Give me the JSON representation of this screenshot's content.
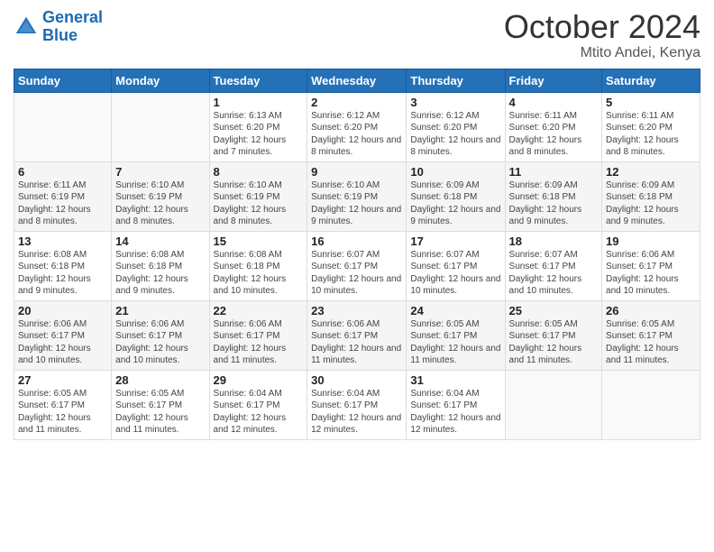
{
  "logo": {
    "line1": "General",
    "line2": "Blue"
  },
  "title": "October 2024",
  "location": "Mtito Andei, Kenya",
  "days_of_week": [
    "Sunday",
    "Monday",
    "Tuesday",
    "Wednesday",
    "Thursday",
    "Friday",
    "Saturday"
  ],
  "weeks": [
    [
      {
        "day": "",
        "sunrise": "",
        "sunset": "",
        "daylight": "",
        "empty": true
      },
      {
        "day": "",
        "sunrise": "",
        "sunset": "",
        "daylight": "",
        "empty": true
      },
      {
        "day": "1",
        "sunrise": "Sunrise: 6:13 AM",
        "sunset": "Sunset: 6:20 PM",
        "daylight": "Daylight: 12 hours and 7 minutes."
      },
      {
        "day": "2",
        "sunrise": "Sunrise: 6:12 AM",
        "sunset": "Sunset: 6:20 PM",
        "daylight": "Daylight: 12 hours and 8 minutes."
      },
      {
        "day": "3",
        "sunrise": "Sunrise: 6:12 AM",
        "sunset": "Sunset: 6:20 PM",
        "daylight": "Daylight: 12 hours and 8 minutes."
      },
      {
        "day": "4",
        "sunrise": "Sunrise: 6:11 AM",
        "sunset": "Sunset: 6:20 PM",
        "daylight": "Daylight: 12 hours and 8 minutes."
      },
      {
        "day": "5",
        "sunrise": "Sunrise: 6:11 AM",
        "sunset": "Sunset: 6:20 PM",
        "daylight": "Daylight: 12 hours and 8 minutes."
      }
    ],
    [
      {
        "day": "6",
        "sunrise": "Sunrise: 6:11 AM",
        "sunset": "Sunset: 6:19 PM",
        "daylight": "Daylight: 12 hours and 8 minutes."
      },
      {
        "day": "7",
        "sunrise": "Sunrise: 6:10 AM",
        "sunset": "Sunset: 6:19 PM",
        "daylight": "Daylight: 12 hours and 8 minutes."
      },
      {
        "day": "8",
        "sunrise": "Sunrise: 6:10 AM",
        "sunset": "Sunset: 6:19 PM",
        "daylight": "Daylight: 12 hours and 8 minutes."
      },
      {
        "day": "9",
        "sunrise": "Sunrise: 6:10 AM",
        "sunset": "Sunset: 6:19 PM",
        "daylight": "Daylight: 12 hours and 9 minutes."
      },
      {
        "day": "10",
        "sunrise": "Sunrise: 6:09 AM",
        "sunset": "Sunset: 6:18 PM",
        "daylight": "Daylight: 12 hours and 9 minutes."
      },
      {
        "day": "11",
        "sunrise": "Sunrise: 6:09 AM",
        "sunset": "Sunset: 6:18 PM",
        "daylight": "Daylight: 12 hours and 9 minutes."
      },
      {
        "day": "12",
        "sunrise": "Sunrise: 6:09 AM",
        "sunset": "Sunset: 6:18 PM",
        "daylight": "Daylight: 12 hours and 9 minutes."
      }
    ],
    [
      {
        "day": "13",
        "sunrise": "Sunrise: 6:08 AM",
        "sunset": "Sunset: 6:18 PM",
        "daylight": "Daylight: 12 hours and 9 minutes."
      },
      {
        "day": "14",
        "sunrise": "Sunrise: 6:08 AM",
        "sunset": "Sunset: 6:18 PM",
        "daylight": "Daylight: 12 hours and 9 minutes."
      },
      {
        "day": "15",
        "sunrise": "Sunrise: 6:08 AM",
        "sunset": "Sunset: 6:18 PM",
        "daylight": "Daylight: 12 hours and 10 minutes."
      },
      {
        "day": "16",
        "sunrise": "Sunrise: 6:07 AM",
        "sunset": "Sunset: 6:17 PM",
        "daylight": "Daylight: 12 hours and 10 minutes."
      },
      {
        "day": "17",
        "sunrise": "Sunrise: 6:07 AM",
        "sunset": "Sunset: 6:17 PM",
        "daylight": "Daylight: 12 hours and 10 minutes."
      },
      {
        "day": "18",
        "sunrise": "Sunrise: 6:07 AM",
        "sunset": "Sunset: 6:17 PM",
        "daylight": "Daylight: 12 hours and 10 minutes."
      },
      {
        "day": "19",
        "sunrise": "Sunrise: 6:06 AM",
        "sunset": "Sunset: 6:17 PM",
        "daylight": "Daylight: 12 hours and 10 minutes."
      }
    ],
    [
      {
        "day": "20",
        "sunrise": "Sunrise: 6:06 AM",
        "sunset": "Sunset: 6:17 PM",
        "daylight": "Daylight: 12 hours and 10 minutes."
      },
      {
        "day": "21",
        "sunrise": "Sunrise: 6:06 AM",
        "sunset": "Sunset: 6:17 PM",
        "daylight": "Daylight: 12 hours and 10 minutes."
      },
      {
        "day": "22",
        "sunrise": "Sunrise: 6:06 AM",
        "sunset": "Sunset: 6:17 PM",
        "daylight": "Daylight: 12 hours and 11 minutes."
      },
      {
        "day": "23",
        "sunrise": "Sunrise: 6:06 AM",
        "sunset": "Sunset: 6:17 PM",
        "daylight": "Daylight: 12 hours and 11 minutes."
      },
      {
        "day": "24",
        "sunrise": "Sunrise: 6:05 AM",
        "sunset": "Sunset: 6:17 PM",
        "daylight": "Daylight: 12 hours and 11 minutes."
      },
      {
        "day": "25",
        "sunrise": "Sunrise: 6:05 AM",
        "sunset": "Sunset: 6:17 PM",
        "daylight": "Daylight: 12 hours and 11 minutes."
      },
      {
        "day": "26",
        "sunrise": "Sunrise: 6:05 AM",
        "sunset": "Sunset: 6:17 PM",
        "daylight": "Daylight: 12 hours and 11 minutes."
      }
    ],
    [
      {
        "day": "27",
        "sunrise": "Sunrise: 6:05 AM",
        "sunset": "Sunset: 6:17 PM",
        "daylight": "Daylight: 12 hours and 11 minutes."
      },
      {
        "day": "28",
        "sunrise": "Sunrise: 6:05 AM",
        "sunset": "Sunset: 6:17 PM",
        "daylight": "Daylight: 12 hours and 11 minutes."
      },
      {
        "day": "29",
        "sunrise": "Sunrise: 6:04 AM",
        "sunset": "Sunset: 6:17 PM",
        "daylight": "Daylight: 12 hours and 12 minutes."
      },
      {
        "day": "30",
        "sunrise": "Sunrise: 6:04 AM",
        "sunset": "Sunset: 6:17 PM",
        "daylight": "Daylight: 12 hours and 12 minutes."
      },
      {
        "day": "31",
        "sunrise": "Sunrise: 6:04 AM",
        "sunset": "Sunset: 6:17 PM",
        "daylight": "Daylight: 12 hours and 12 minutes."
      },
      {
        "day": "",
        "sunrise": "",
        "sunset": "",
        "daylight": "",
        "empty": true
      },
      {
        "day": "",
        "sunrise": "",
        "sunset": "",
        "daylight": "",
        "empty": true
      }
    ]
  ]
}
